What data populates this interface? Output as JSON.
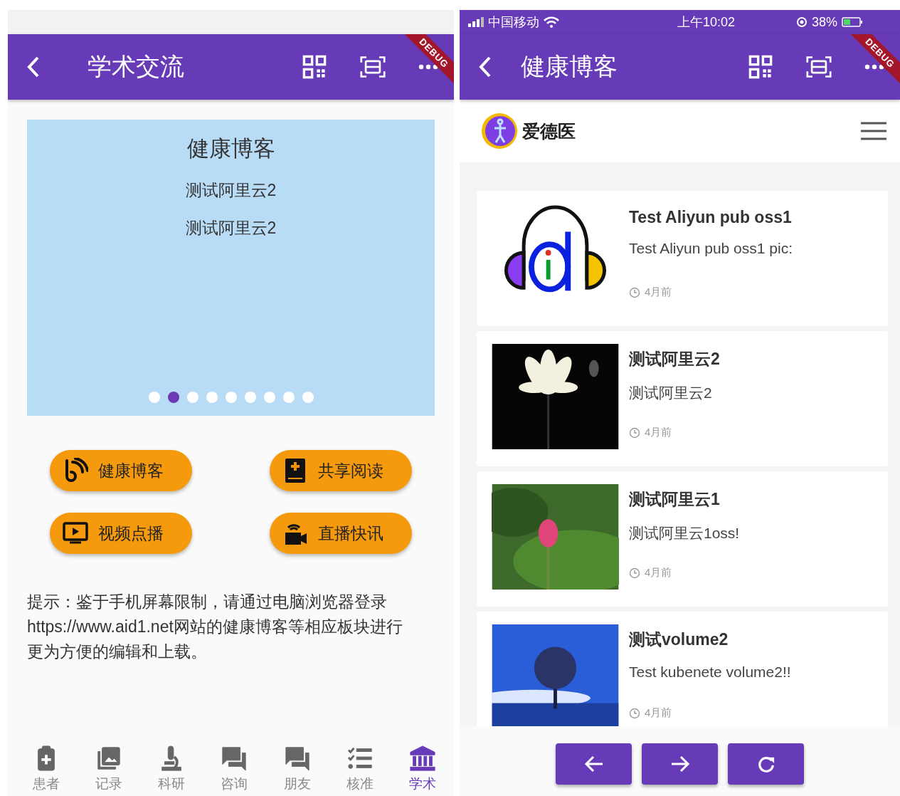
{
  "left_screen": {
    "app_bar": {
      "title": "学术交流",
      "debug_banner": "DEBUG"
    },
    "carousel": {
      "title": "健康博客",
      "lines": [
        "测试阿里云2",
        "测试阿里云2"
      ],
      "dots": [
        {
          "selected": false
        },
        {
          "selected": true
        },
        {
          "selected": false
        },
        {
          "selected": false
        },
        {
          "selected": false
        },
        {
          "selected": false
        },
        {
          "selected": false
        },
        {
          "selected": false
        },
        {
          "selected": false
        }
      ]
    },
    "shortcut_buttons": [
      {
        "kind": "blog",
        "label": "健康博客"
      },
      {
        "kind": "book",
        "label": "共享阅读"
      },
      {
        "kind": "video",
        "label": "视频点播"
      },
      {
        "kind": "live",
        "label": "直播快讯"
      }
    ],
    "tip": "提示：鉴于手机屏幕限制，请通过电脑浏览器登录https://www.aid1.net网站的健康博客等相应板块进行更为方便的编辑和上载。",
    "bottom_nav": [
      {
        "kind": "patient",
        "label": "患者",
        "selected": false
      },
      {
        "kind": "records",
        "label": "记录",
        "selected": false
      },
      {
        "kind": "research",
        "label": "科研",
        "selected": false
      },
      {
        "kind": "consult",
        "label": "咨询",
        "selected": false
      },
      {
        "kind": "friends",
        "label": "朋友",
        "selected": false
      },
      {
        "kind": "verify",
        "label": "核准",
        "selected": false
      },
      {
        "kind": "academic",
        "label": "学术",
        "selected": true
      }
    ]
  },
  "right_screen": {
    "status_bar": {
      "carrier": "中国移动",
      "time": "上午10:02",
      "battery": "38%"
    },
    "app_bar": {
      "title": "健康博客",
      "debug_banner": "DEBUG"
    },
    "site_header": {
      "brand": "爱德医"
    },
    "posts": [
      {
        "kind": "logo",
        "title": "Test Aliyun pub oss1",
        "summary": "Test Aliyun pub oss1 pic:",
        "time": "4月前"
      },
      {
        "kind": "dark-flower",
        "title": "测试阿里云2",
        "summary": "测试阿里云2",
        "time": "4月前"
      },
      {
        "kind": "green-flower",
        "title": "测试阿里云1",
        "summary": "测试阿里云1oss!",
        "time": "4月前"
      },
      {
        "kind": "sky-tree",
        "title": "测试volume2",
        "summary": "Test kubenete volume2!!",
        "time": "4月前"
      }
    ],
    "nav_buttons": [
      {
        "kind": "back"
      },
      {
        "kind": "forward"
      },
      {
        "kind": "reload"
      }
    ]
  }
}
